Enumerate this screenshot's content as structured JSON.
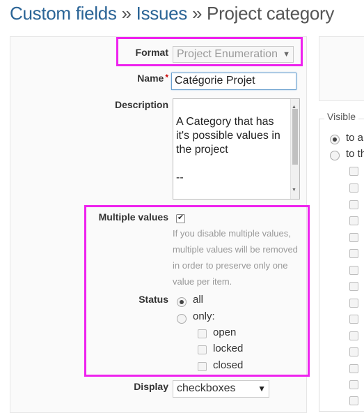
{
  "breadcrumb": {
    "custom_fields": "Custom fields",
    "sep1": "»",
    "issues": "Issues",
    "sep2": "»",
    "current": "Project category"
  },
  "form": {
    "format": {
      "label": "Format",
      "value": "Project Enumeration"
    },
    "name": {
      "label": "Name",
      "required_mark": "*",
      "value": "Catégorie Projet"
    },
    "description": {
      "label": "Description",
      "value": "A Category that has it's possible values in the project\n\n--\n\nUne Catégorie qui"
    },
    "multiple_values": {
      "label": "Multiple values",
      "checked": true,
      "hint": "If you disable multiple values, multiple values will be removed in order to preserve only one value per item."
    },
    "status": {
      "label": "Status",
      "all_label": "all",
      "only_label": "only:",
      "options": [
        "open",
        "locked",
        "closed"
      ]
    },
    "display": {
      "label": "Display",
      "value": "checkboxes"
    }
  },
  "visible_panel": {
    "legend": "Visible",
    "option1": "to a",
    "option2": "to th"
  },
  "colors": {
    "link": "#2a6496",
    "highlight": "#ee22ee",
    "required": "#cc0000"
  }
}
